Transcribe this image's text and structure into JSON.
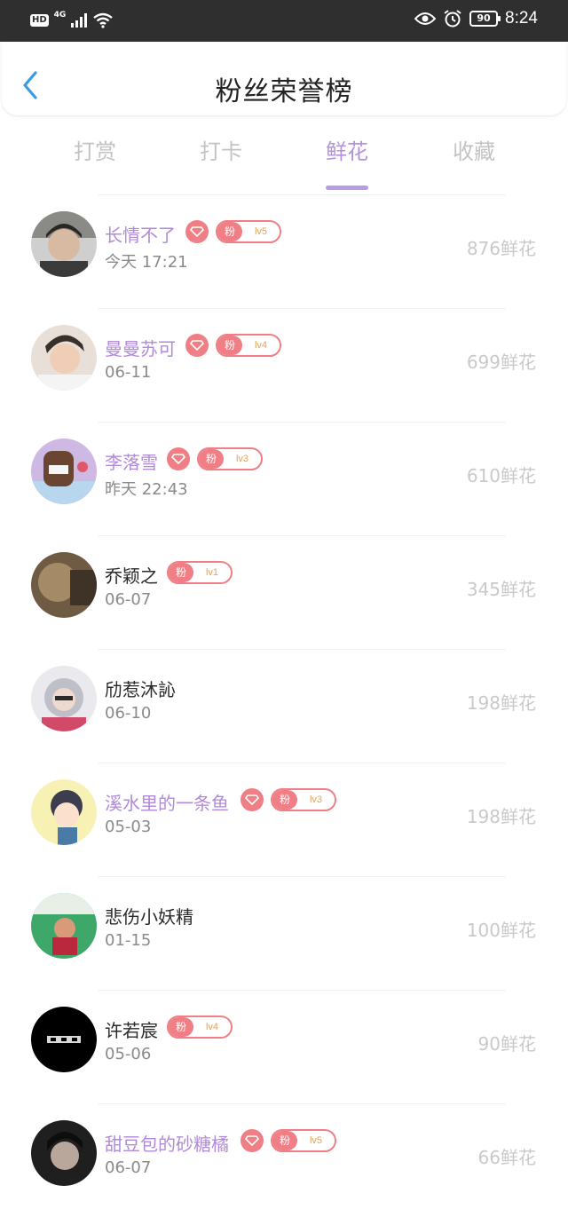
{
  "status_bar": {
    "hd": "HD",
    "network": "4G",
    "battery": "90",
    "time": "8:24"
  },
  "header": {
    "title": "粉丝荣誉榜"
  },
  "tabs": [
    {
      "label": "打赏"
    },
    {
      "label": "打卡"
    },
    {
      "label": "鲜花"
    },
    {
      "label": "收藏"
    }
  ],
  "badge": {
    "fan_label": "粉"
  },
  "fans": [
    {
      "name": "长情不了",
      "date": "今天 17:21",
      "flowers": "876鲜花",
      "level": "lv5",
      "vip": true
    },
    {
      "name": "曼曼苏可",
      "date": "06-11",
      "flowers": "699鲜花",
      "level": "lv4",
      "vip": true
    },
    {
      "name": "李落雪",
      "date": "昨天 22:43",
      "flowers": "610鲜花",
      "level": "lv3",
      "vip": true
    },
    {
      "name": "乔颖之",
      "date": "06-07",
      "flowers": "345鲜花",
      "level": "lv1",
      "vip": false
    },
    {
      "name": "劤惹沐訫",
      "date": "06-10",
      "flowers": "198鲜花",
      "level": "",
      "vip": false
    },
    {
      "name": "溪水里的一条鱼",
      "date": "05-03",
      "flowers": "198鲜花",
      "level": "lv3",
      "vip": true
    },
    {
      "name": "悲伤小妖精",
      "date": "01-15",
      "flowers": "100鲜花",
      "level": "",
      "vip": false
    },
    {
      "name": "许若宸",
      "date": "05-06",
      "flowers": "90鲜花",
      "level": "lv4",
      "vip": false
    },
    {
      "name": "甜豆包的砂糖橘",
      "date": "06-07",
      "flowers": "66鲜花",
      "level": "lv5",
      "vip": true
    }
  ],
  "colors": {
    "accent": "#b99ce3",
    "vip_name": "#b08ad9",
    "badge": "#ef7f85",
    "level_text": "#e9a24f"
  }
}
